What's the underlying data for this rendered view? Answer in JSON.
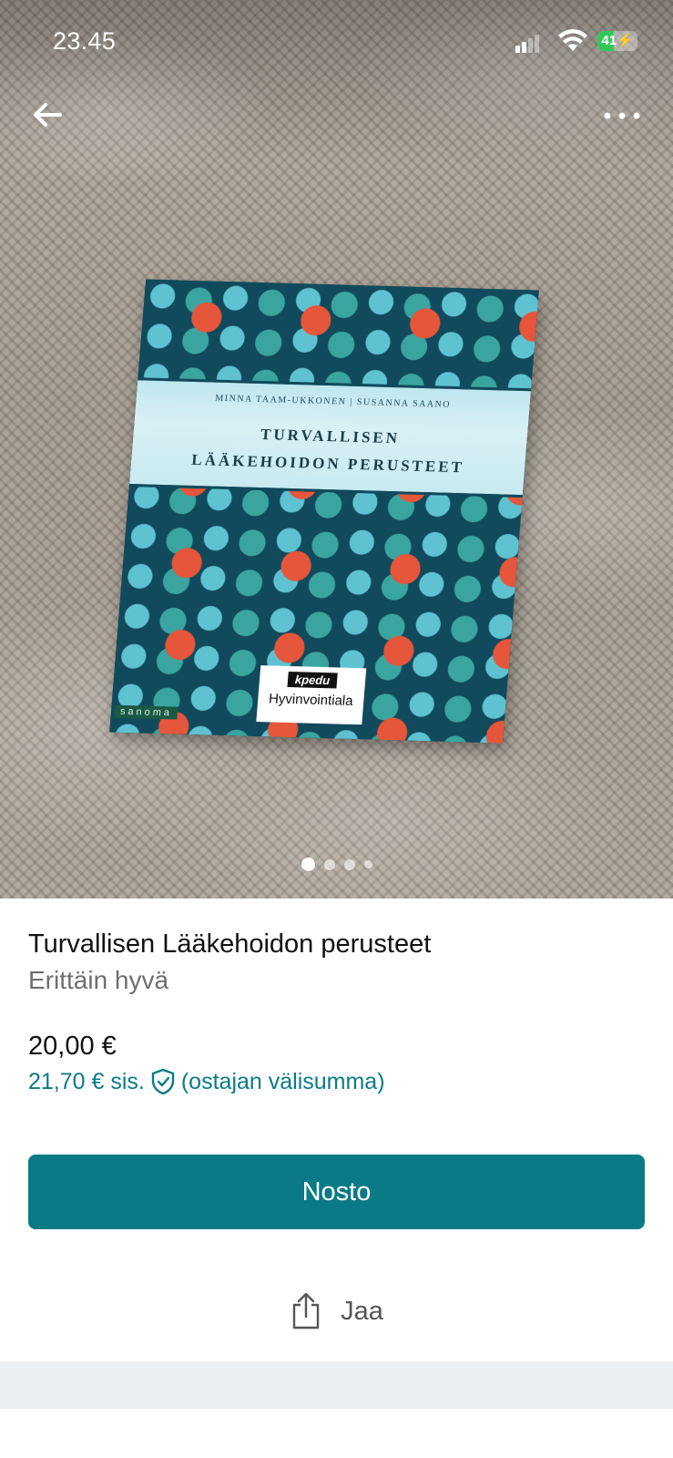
{
  "status_bar": {
    "time": "23.45",
    "battery": "41",
    "battery_level": 0.41
  },
  "nav": {
    "back_icon": "arrow-left-icon",
    "more_icon": "more-horizontal-icon"
  },
  "photo": {
    "book_authors": "MINNA TAAM-UKKONEN  |  SUSANNA SAANO",
    "book_title_line1": "TURVALLISEN",
    "book_title_line2": "LÄÄKEHOIDON PERUSTEET",
    "sticker_logo": "kpedu",
    "sticker_text": "Hyvinvointiala",
    "publisher": "sanoma",
    "pager": {
      "count": 4,
      "active": 0
    }
  },
  "listing": {
    "title": "Turvallisen Lääkehoidon perusteet",
    "condition": "Erittäin hyvä",
    "price": "20,00 €",
    "buyer_price": "21,70 € sis.",
    "buyer_note": "(ostajan välisumma)"
  },
  "actions": {
    "buy_label": "Nosto",
    "share_label": "Jaa"
  },
  "colors": {
    "accent": "#0a7b86",
    "battery_green": "#34c759"
  }
}
